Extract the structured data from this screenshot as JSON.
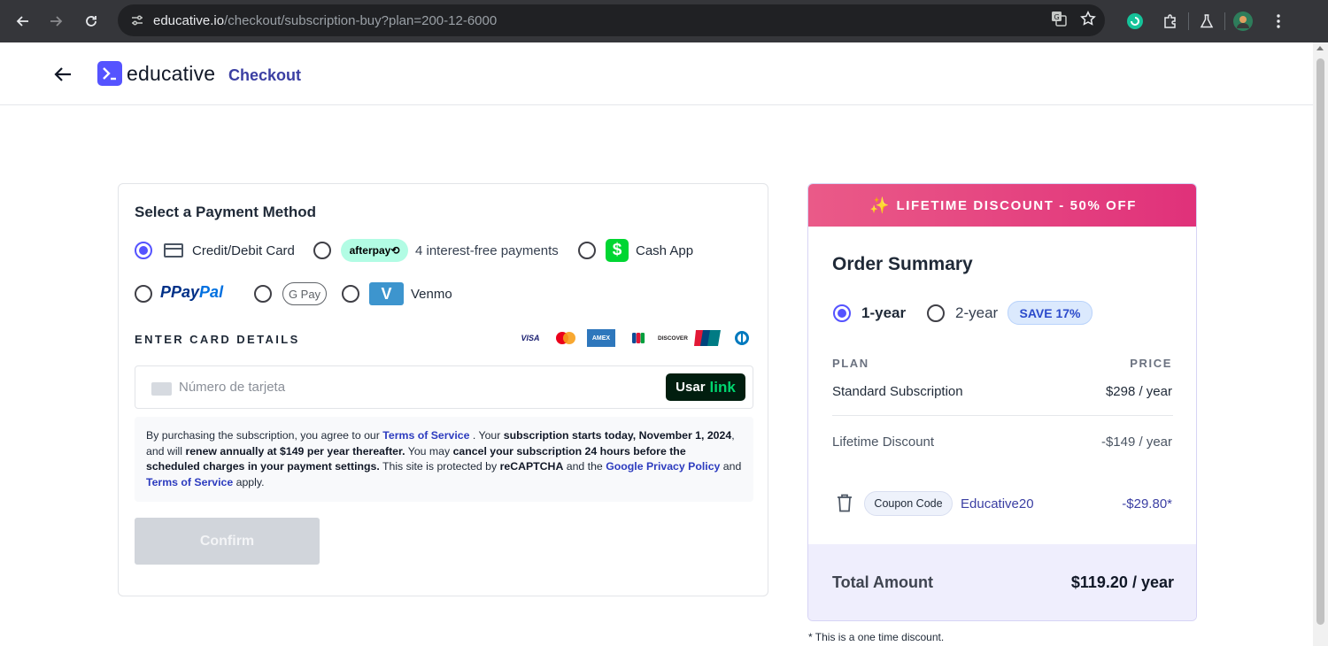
{
  "browser": {
    "url_host": "educative.io",
    "url_path": "/checkout/subscription-buy?plan=200-12-6000"
  },
  "header": {
    "logo_text": "educative",
    "checkout_label": "Checkout"
  },
  "payment": {
    "title": "Select a Payment Method",
    "methods": {
      "card_label": "Credit/Debit Card",
      "afterpay_logo": "afterpay⟲",
      "afterpay_label": "4 interest-free payments",
      "cashapp_label": "Cash App",
      "paypal_logo_a": "Pay",
      "paypal_logo_b": "Pal",
      "gpay_logo": "G Pay",
      "venmo_label": "Venmo"
    },
    "selected_method": "card",
    "enter_card_heading": "ENTER CARD DETAILS",
    "card_brands": [
      "VISA",
      "Mastercard",
      "AMEX",
      "JCB",
      "DISCOVER",
      "UnionPay",
      "Diners"
    ],
    "card_placeholder": "Número de tarjeta",
    "link_button": {
      "part1": "Usar",
      "part2": "link"
    },
    "terms": {
      "t1": "By purchasing the subscription, you agree to our ",
      "tos1": "Terms of Service",
      "t2": " . Your ",
      "b1": "subscription starts today, November 1, 2024",
      "t3": ", and will ",
      "b2": "renew annually at $149 per year thereafter.",
      "t4": " You may ",
      "b3": "cancel your subscription 24 hours before the scheduled charges in your payment settings.",
      "t5": " This site is protected by ",
      "b4": "reCAPTCHA",
      "t6": " and the ",
      "privacy": "Google Privacy Policy",
      "t7": " and ",
      "tos2": "Terms of Service",
      "t8": " apply."
    },
    "confirm_label": "Confirm"
  },
  "summary": {
    "banner": "LIFETIME DISCOUNT - 50% OFF",
    "title": "Order Summary",
    "plan_options": [
      "1-year",
      "2-year"
    ],
    "selected_plan": "1-year",
    "save_badge": "SAVE 17%",
    "col_plan": "PLAN",
    "col_price": "PRICE",
    "rows": [
      {
        "label": "Standard Subscription",
        "value": "$298 / year"
      },
      {
        "label": "Lifetime Discount",
        "value": "-$149 / year"
      }
    ],
    "coupon": {
      "pill": "Coupon Code",
      "code": "Educative20",
      "value": "-$29.80*"
    },
    "total_label": "Total Amount",
    "total_value": "$119.20 / year",
    "footnote": "* This is a one time discount."
  },
  "colors": {
    "brand": "#5553ff",
    "banner_start": "#ea5a88",
    "banner_end": "#e0317a",
    "link_blue": "#2d3cbf",
    "total_bg": "#efeefd"
  }
}
